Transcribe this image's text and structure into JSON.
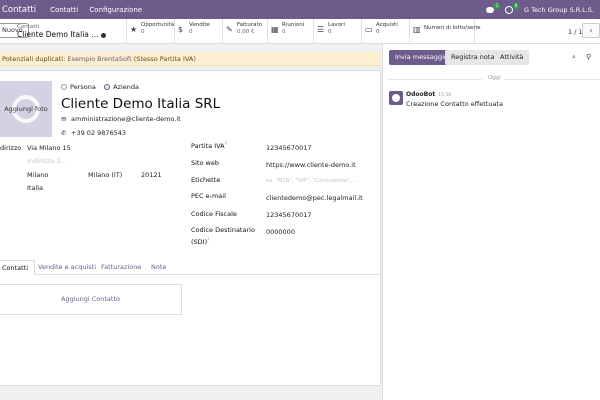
{
  "navbar": {
    "app_name": "Contatti",
    "menu": [
      "Contatti",
      "Configurazione"
    ],
    "chat_badge": "1",
    "activity_badge": "6",
    "company": "G Tech Group S.R.L.S."
  },
  "control_panel": {
    "new_label": "Nuovo",
    "breadcrumb": "Contatti",
    "record_title": "Cliente Demo Italia ...",
    "stats": [
      {
        "label": "Opportunità",
        "value": "0",
        "icon": "star-icon"
      },
      {
        "label": "Vendite",
        "value": "0",
        "icon": "dollar-icon"
      },
      {
        "label": "Fatturato",
        "value": "0,00 €",
        "icon": "edit-icon"
      },
      {
        "label": "Riunioni",
        "value": "0",
        "icon": "calendar-icon"
      },
      {
        "label": "Lavori",
        "value": "0",
        "icon": "list-icon"
      },
      {
        "label": "Acquisti",
        "value": "0",
        "icon": "credit-card-icon"
      },
      {
        "label": "Numeri di lotto/serie",
        "value": "",
        "icon": "barcode-icon"
      }
    ],
    "pager": "1 / 1"
  },
  "alert": {
    "prefix": "Potenziali duplicati:",
    "link": "Esempio BrentaSoft",
    "suffix": "(Stesso Partita IVA)"
  },
  "form": {
    "avatar_label": "Aggiungi foto",
    "radio_person": "Persona",
    "radio_company": "Azienda",
    "name": "Cliente Demo Italia SRL",
    "email": "amministrazione@cliente-demo.it",
    "phone": "+39 02 9876543",
    "address_label": "Indirizzo",
    "street": "Via Milano 15",
    "street2_placeholder": "Indirizzo 2...",
    "city": "Milano",
    "state": "Milano (IT)",
    "zip": "20121",
    "country": "Italia",
    "fields": [
      {
        "label": "Partita IVA",
        "value": "12345670017",
        "placeholder": false,
        "help": "?"
      },
      {
        "label": "Sito web",
        "value": "https://www.cliente-demo.it",
        "placeholder": false,
        "help": ""
      },
      {
        "label": "Etichette",
        "value": "es. \"B2B\", \"VIP\", \"Consulenza\", ...",
        "placeholder": true,
        "help": ""
      },
      {
        "label": "PEC e-mail",
        "value": "clientedemo@pec.legalmail.it",
        "placeholder": false,
        "help": ""
      },
      {
        "label": "Codice Fiscale",
        "value": "12345670017",
        "placeholder": false,
        "help": ""
      },
      {
        "label": "Codice Destinatario (SDI)",
        "value": "0000000",
        "placeholder": false,
        "help": "?"
      }
    ],
    "tabs": [
      "Contatti",
      "Vendite e acquisti",
      "Fatturazione",
      "Note"
    ],
    "add_contact": "Aggiungi Contatto"
  },
  "chatter": {
    "send_message": "Invia messaggio",
    "log_note": "Registra nota",
    "activity": "Attività",
    "date_separator": "Oggi",
    "message": {
      "author": "OdooBot",
      "time": "15:56",
      "body": "Creazione Contatto effettuata"
    }
  }
}
